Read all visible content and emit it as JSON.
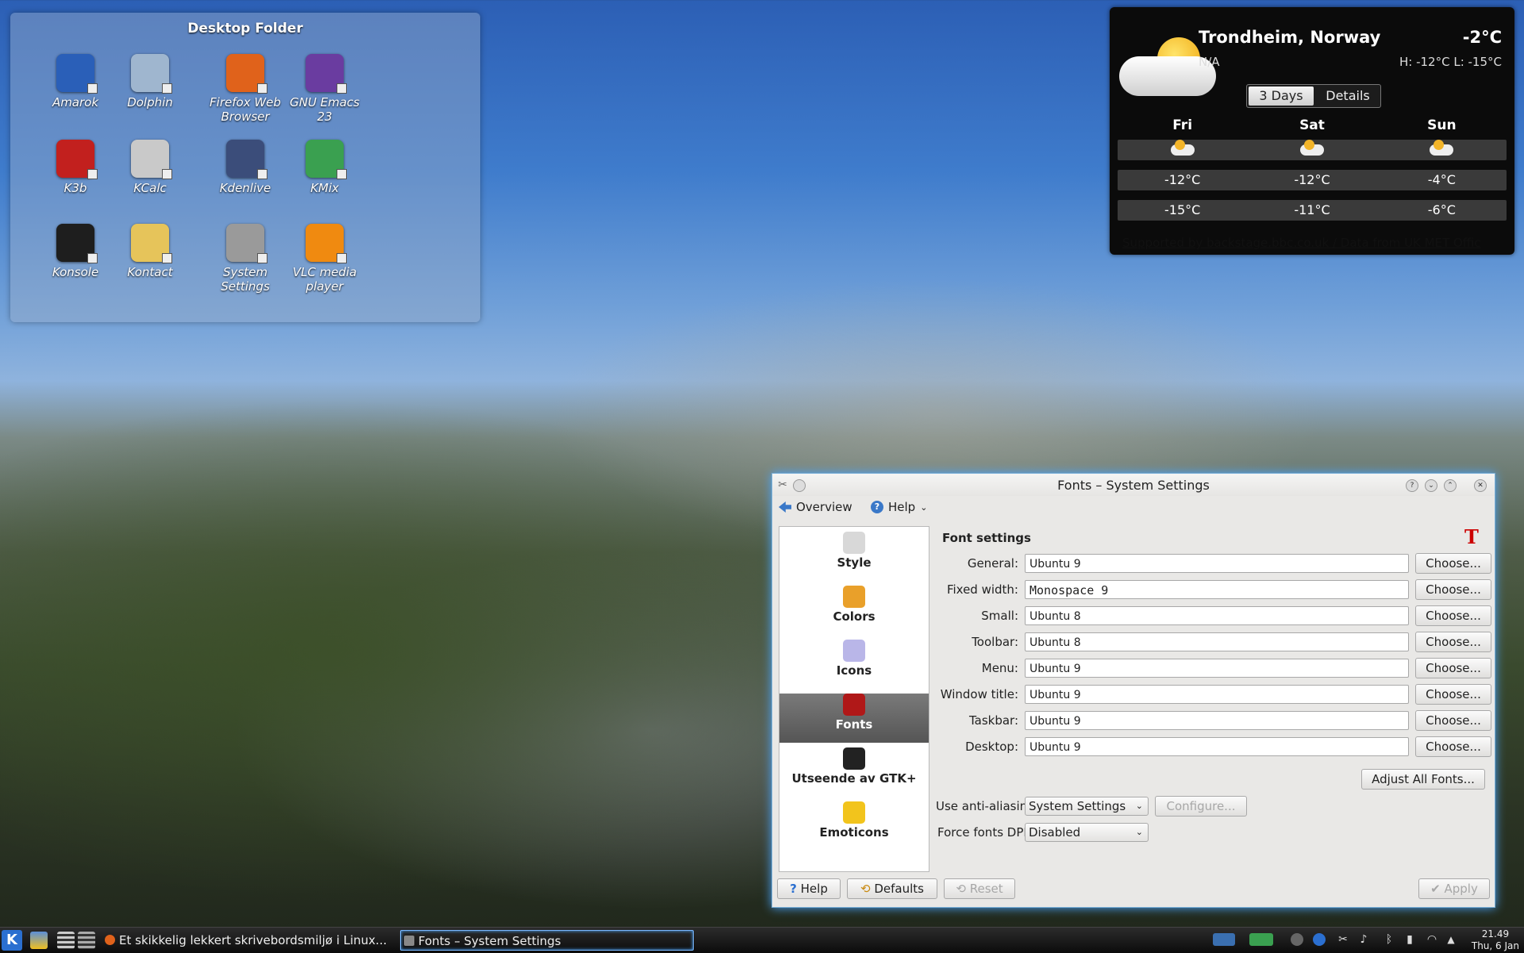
{
  "desktop_folder": {
    "title": "Desktop Folder",
    "icons": [
      {
        "label": "Amarok",
        "icon": "amarok-wolf-icon",
        "color": "#2a5fb8"
      },
      {
        "label": "Dolphin",
        "icon": "dolphin-filemanager-icon",
        "color": "#9fb6cf"
      },
      {
        "label": "Firefox Web Browser",
        "icon": "firefox-icon",
        "color": "#e0621b"
      },
      {
        "label": "GNU Emacs 23",
        "icon": "emacs-icon",
        "color": "#6a3ca0"
      },
      {
        "label": "K3b",
        "icon": "k3b-icon",
        "color": "#c2201e"
      },
      {
        "label": "KCalc",
        "icon": "calculator-icon",
        "color": "#c9c9c9"
      },
      {
        "label": "Kdenlive",
        "icon": "kdenlive-clapper-icon",
        "color": "#3b4d7a"
      },
      {
        "label": "KMix",
        "icon": "kmix-speaker-icon",
        "color": "#3aa050"
      },
      {
        "label": "Konsole",
        "icon": "terminal-icon",
        "color": "#1e1e1e"
      },
      {
        "label": "Kontact",
        "icon": "kontact-icon",
        "color": "#e6c45a"
      },
      {
        "label": "System Settings",
        "icon": "system-settings-tools-icon",
        "color": "#9a9a9a"
      },
      {
        "label": "VLC media player",
        "icon": "vlc-cone-icon",
        "color": "#f08a10"
      }
    ]
  },
  "weather": {
    "city": "Trondheim, Norway",
    "temperature": "-2°C",
    "condition": "N/A",
    "high_low": "H: -12°C L: -15°C",
    "tabs": [
      "3 Days",
      "Details"
    ],
    "active_tab": "3 Days",
    "days": [
      "Fri",
      "Sat",
      "Sun"
    ],
    "highs": [
      "-12°C",
      "-12°C",
      "-4°C"
    ],
    "lows": [
      "-15°C",
      "-11°C",
      "-6°C"
    ],
    "credit": "Supported by backstage.bbc.co.uk / Data from UK MET Offic"
  },
  "window": {
    "title": "Fonts – System Settings",
    "toolbar": {
      "overview": "Overview",
      "help": "Help"
    },
    "sidebar": [
      {
        "label": "Style",
        "icon": "style-brush-icon",
        "color": "#d8d8d8"
      },
      {
        "label": "Colors",
        "icon": "colors-palette-icon",
        "color": "#e9a02a"
      },
      {
        "label": "Icons",
        "icon": "icons-set-icon",
        "color": "#b9b6e8"
      },
      {
        "label": "Fonts",
        "icon": "fonts-icon",
        "color": "#b01818"
      },
      {
        "label": "Utseende av GTK+",
        "icon": "gtk-appearance-icon",
        "color": "#222222"
      },
      {
        "label": "Emoticons",
        "icon": "smiley-icon",
        "color": "#f2c41c"
      }
    ],
    "selected_section": "Fonts",
    "content_title": "Font settings",
    "font_rows": [
      {
        "label": "General:",
        "value": "Ubuntu 9",
        "button": "Choose..."
      },
      {
        "label": "Fixed width:",
        "value": "Monospace 9",
        "button": "Choose..."
      },
      {
        "label": "Small:",
        "value": "Ubuntu 8",
        "button": "Choose..."
      },
      {
        "label": "Toolbar:",
        "value": "Ubuntu 8",
        "button": "Choose..."
      },
      {
        "label": "Menu:",
        "value": "Ubuntu 9",
        "button": "Choose..."
      },
      {
        "label": "Window title:",
        "value": "Ubuntu 9",
        "button": "Choose..."
      },
      {
        "label": "Taskbar:",
        "value": "Ubuntu 9",
        "button": "Choose..."
      },
      {
        "label": "Desktop:",
        "value": "Ubuntu 9",
        "button": "Choose..."
      }
    ],
    "adjust_all": "Adjust All Fonts...",
    "anti_aliasing": {
      "label": "Use anti-aliasing:",
      "value": "System Settings",
      "configure": "Configure..."
    },
    "force_dpi": {
      "label": "Force fonts DPI:",
      "value": "Disabled"
    },
    "buttons": {
      "help": "Help",
      "defaults": "Defaults",
      "reset": "Reset",
      "apply": "Apply"
    }
  },
  "taskbar": {
    "tasks": [
      {
        "label": "Et skikkelig lekkert skrivebordsmiljø i Linux...",
        "active": false
      },
      {
        "label": "Fonts – System Settings",
        "active": true
      }
    ],
    "clock_time": "21.49",
    "clock_date": "Thu, 6 Jan"
  },
  "colors": {
    "accent": "#4aa6ff",
    "selected_sidebar": "#5f5f5f",
    "disabled_text": "#a7a7a7"
  }
}
